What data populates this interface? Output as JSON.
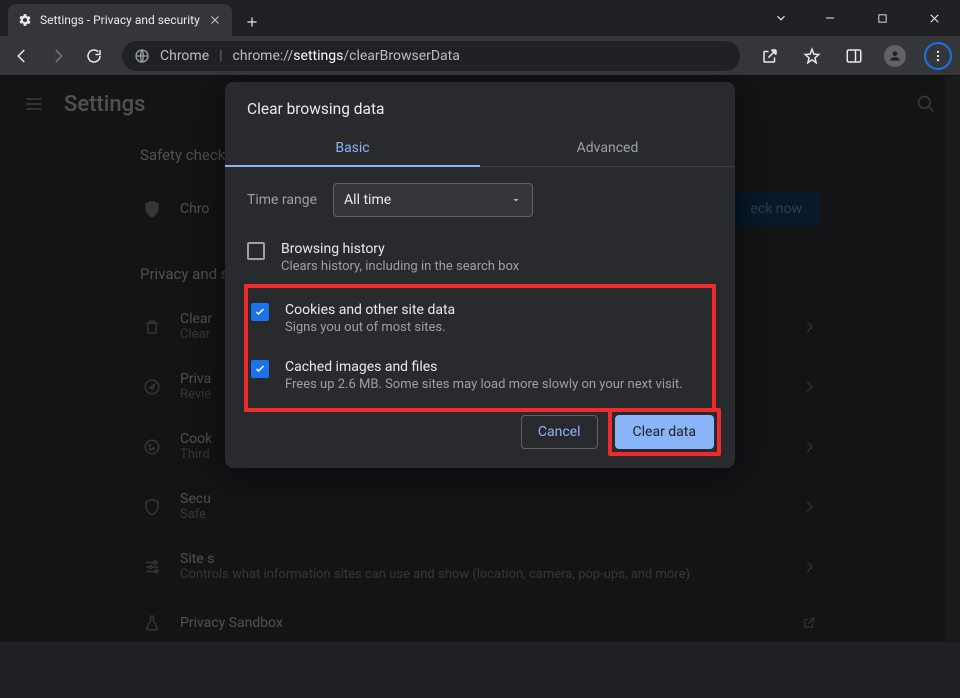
{
  "window": {
    "tab_title": "Settings - Privacy and security"
  },
  "toolbar": {
    "url_prefix": "Chrome",
    "url_scheme": "chrome://",
    "url_bold": "settings",
    "url_tail": "/clearBrowserData"
  },
  "settings": {
    "title": "Settings",
    "sections": {
      "safety": {
        "header": "Safety check",
        "item_label": "Chro",
        "button": "eck now"
      },
      "privacy": {
        "header": "Privacy and s",
        "items": [
          {
            "title": "Clear",
            "sub": "Clear"
          },
          {
            "title": "Priva",
            "sub": "Revie"
          },
          {
            "title": "Cook",
            "sub": "Third"
          },
          {
            "title": "Secu",
            "sub": "Safe"
          },
          {
            "title": "Site s",
            "sub": "Controls what information sites can use and show (location, camera, pop-ups, and more)"
          },
          {
            "title": "Privacy Sandbox",
            "sub": ""
          }
        ]
      }
    }
  },
  "dialog": {
    "title": "Clear browsing data",
    "tabs": {
      "basic": "Basic",
      "advanced": "Advanced"
    },
    "time_label": "Time range",
    "time_value": "All time",
    "opts": [
      {
        "title": "Browsing history",
        "sub": "Clears history, including in the search box",
        "checked": false
      },
      {
        "title": "Cookies and other site data",
        "sub": "Signs you out of most sites.",
        "checked": true
      },
      {
        "title": "Cached images and files",
        "sub": "Frees up 2.6 MB. Some sites may load more slowly on your next visit.",
        "checked": true
      }
    ],
    "cancel": "Cancel",
    "confirm": "Clear data"
  }
}
